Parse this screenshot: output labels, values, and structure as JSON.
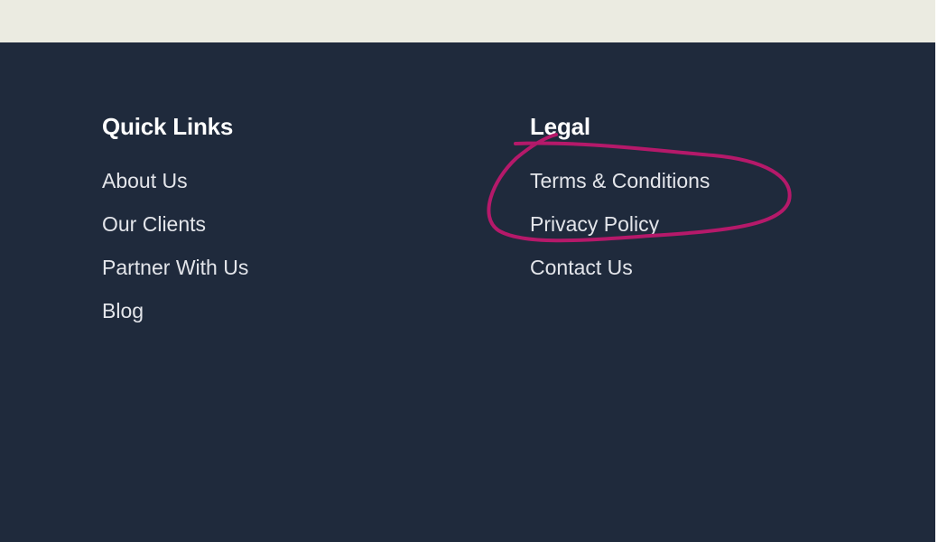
{
  "footer": {
    "quick_links": {
      "heading": "Quick Links",
      "links": [
        {
          "label": "About Us"
        },
        {
          "label": "Our Clients"
        },
        {
          "label": "Partner With Us"
        },
        {
          "label": "Blog"
        }
      ]
    },
    "legal": {
      "heading": "Legal",
      "links": [
        {
          "label": "Terms & Conditions"
        },
        {
          "label": "Privacy Policy"
        },
        {
          "label": "Contact Us"
        }
      ]
    }
  },
  "colors": {
    "footer_background": "#1f2a3c",
    "top_strip": "#ebebe1",
    "heading_text": "#ffffff",
    "link_text": "#e3e5ea",
    "annotation_stroke": "#b5196a"
  }
}
